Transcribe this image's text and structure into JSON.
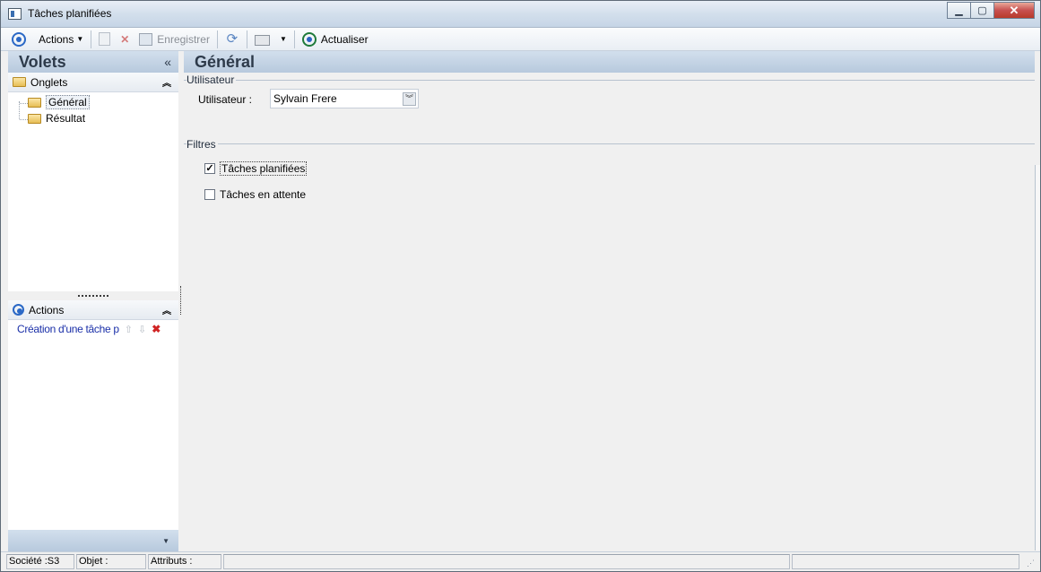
{
  "window": {
    "title": "Tâches planifiées"
  },
  "toolbar": {
    "actions_label": "Actions",
    "save_label": "Enregistrer",
    "refresh_label": "Actualiser"
  },
  "volets": {
    "title": "Volets",
    "collapse_symbol": "«",
    "onglets": {
      "title": "Onglets",
      "items": [
        {
          "label": "Général",
          "selected": true
        },
        {
          "label": "Résultat",
          "selected": false
        }
      ]
    },
    "actions": {
      "title": "Actions",
      "items": [
        {
          "label": "Création d'une tâche p"
        }
      ]
    }
  },
  "main": {
    "title": "Général",
    "utilisateur": {
      "group_title": "Utilisateur",
      "field_label": "Utilisateur :",
      "value": "Sylvain Frere"
    },
    "filtres": {
      "group_title": "Filtres",
      "options": [
        {
          "label": "Tâches planifiées",
          "checked": true
        },
        {
          "label": "Tâches en attente",
          "checked": false
        }
      ]
    }
  },
  "statusbar": {
    "societe": "Société :S3",
    "objet": "Objet :",
    "attributs": "Attributs :"
  },
  "icons": {
    "app": "window-icon",
    "actions": "target-icon",
    "refresh": "refresh-icon",
    "actualiser": "actualiser-icon",
    "print": "printer-icon"
  }
}
